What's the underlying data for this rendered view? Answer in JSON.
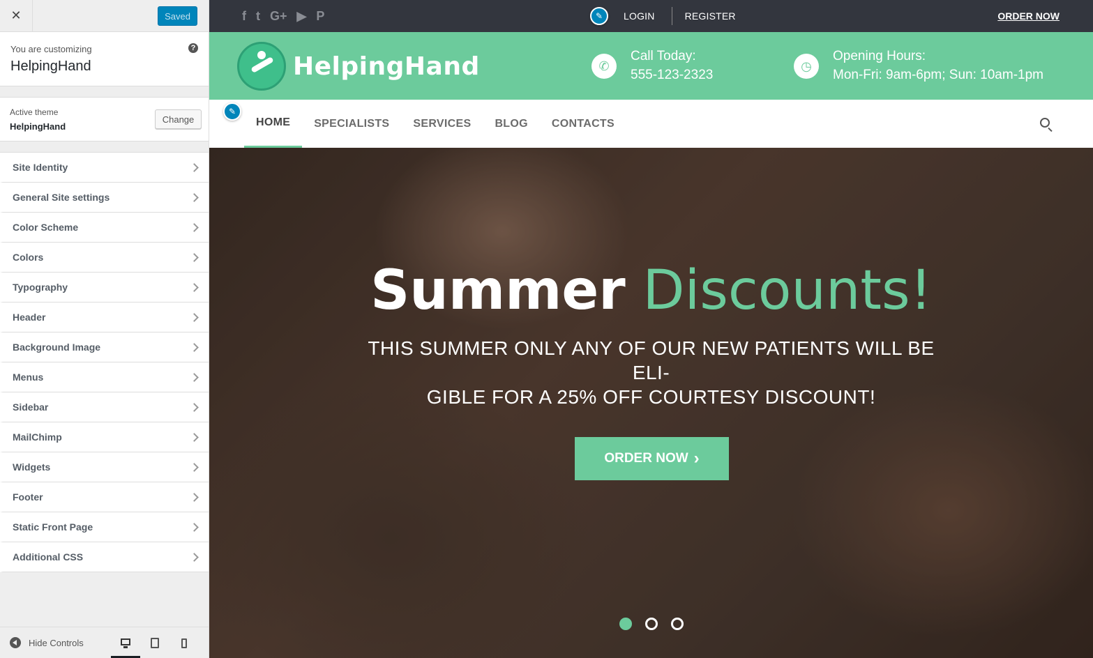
{
  "customizer": {
    "close_glyph": "✕",
    "saved_label": "Saved",
    "customizing_label": "You are customizing",
    "site_name": "HelpingHand",
    "help_glyph": "?",
    "active_theme_label": "Active theme",
    "active_theme_name": "HelpingHand",
    "change_label": "Change",
    "sections": [
      {
        "label": "Site Identity"
      },
      {
        "label": "General Site settings"
      },
      {
        "label": "Color Scheme"
      },
      {
        "label": "Colors"
      },
      {
        "label": "Typography"
      },
      {
        "label": "Header"
      },
      {
        "label": "Background Image"
      },
      {
        "label": "Menus"
      },
      {
        "label": "Sidebar"
      },
      {
        "label": "MailChimp"
      },
      {
        "label": "Widgets"
      },
      {
        "label": "Footer"
      },
      {
        "label": "Static Front Page"
      },
      {
        "label": "Additional CSS"
      }
    ],
    "hide_controls_label": "Hide Controls",
    "preview_devices": [
      "desktop",
      "tablet",
      "mobile"
    ],
    "active_device": "desktop"
  },
  "site": {
    "social_icons": [
      {
        "name": "facebook-icon",
        "glyph": "f"
      },
      {
        "name": "twitter-icon",
        "glyph": "t"
      },
      {
        "name": "google-plus-icon",
        "glyph": "G+"
      },
      {
        "name": "youtube-icon",
        "glyph": "▶"
      },
      {
        "name": "pinterest-icon",
        "glyph": "P"
      }
    ],
    "login_label": "LOGIN",
    "register_label": "REGISTER",
    "order_now_top": "ORDER NOW",
    "logo_text": "HelpingHand",
    "call_label": "Call Today:",
    "call_value": "555-123-2323",
    "hours_label": "Opening Hours:",
    "hours_value": "Mon-Fri: 9am-6pm; Sun: 10am-1pm",
    "nav": [
      {
        "label": "HOME",
        "active": true
      },
      {
        "label": "SPECIALISTS",
        "active": false
      },
      {
        "label": "SERVICES",
        "active": false
      },
      {
        "label": "BLOG",
        "active": false
      },
      {
        "label": "CONTACTS",
        "active": false
      }
    ],
    "hero": {
      "title_white": "Summer",
      "title_green": "Discounts!",
      "subtitle_line1": "THIS SUMMER ONLY ANY OF OUR NEW PATIENTS WILL BE ELI-",
      "subtitle_line2": "GIBLE FOR A 25% OFF COURTESY DISCOUNT!",
      "button_label": "ORDER NOW",
      "button_chevron": "›",
      "slide_count": 3,
      "active_slide": 1
    },
    "colors": {
      "accent": "#6ccb9c",
      "topbar": "#33363e",
      "wp_blue": "#0085ba"
    }
  }
}
